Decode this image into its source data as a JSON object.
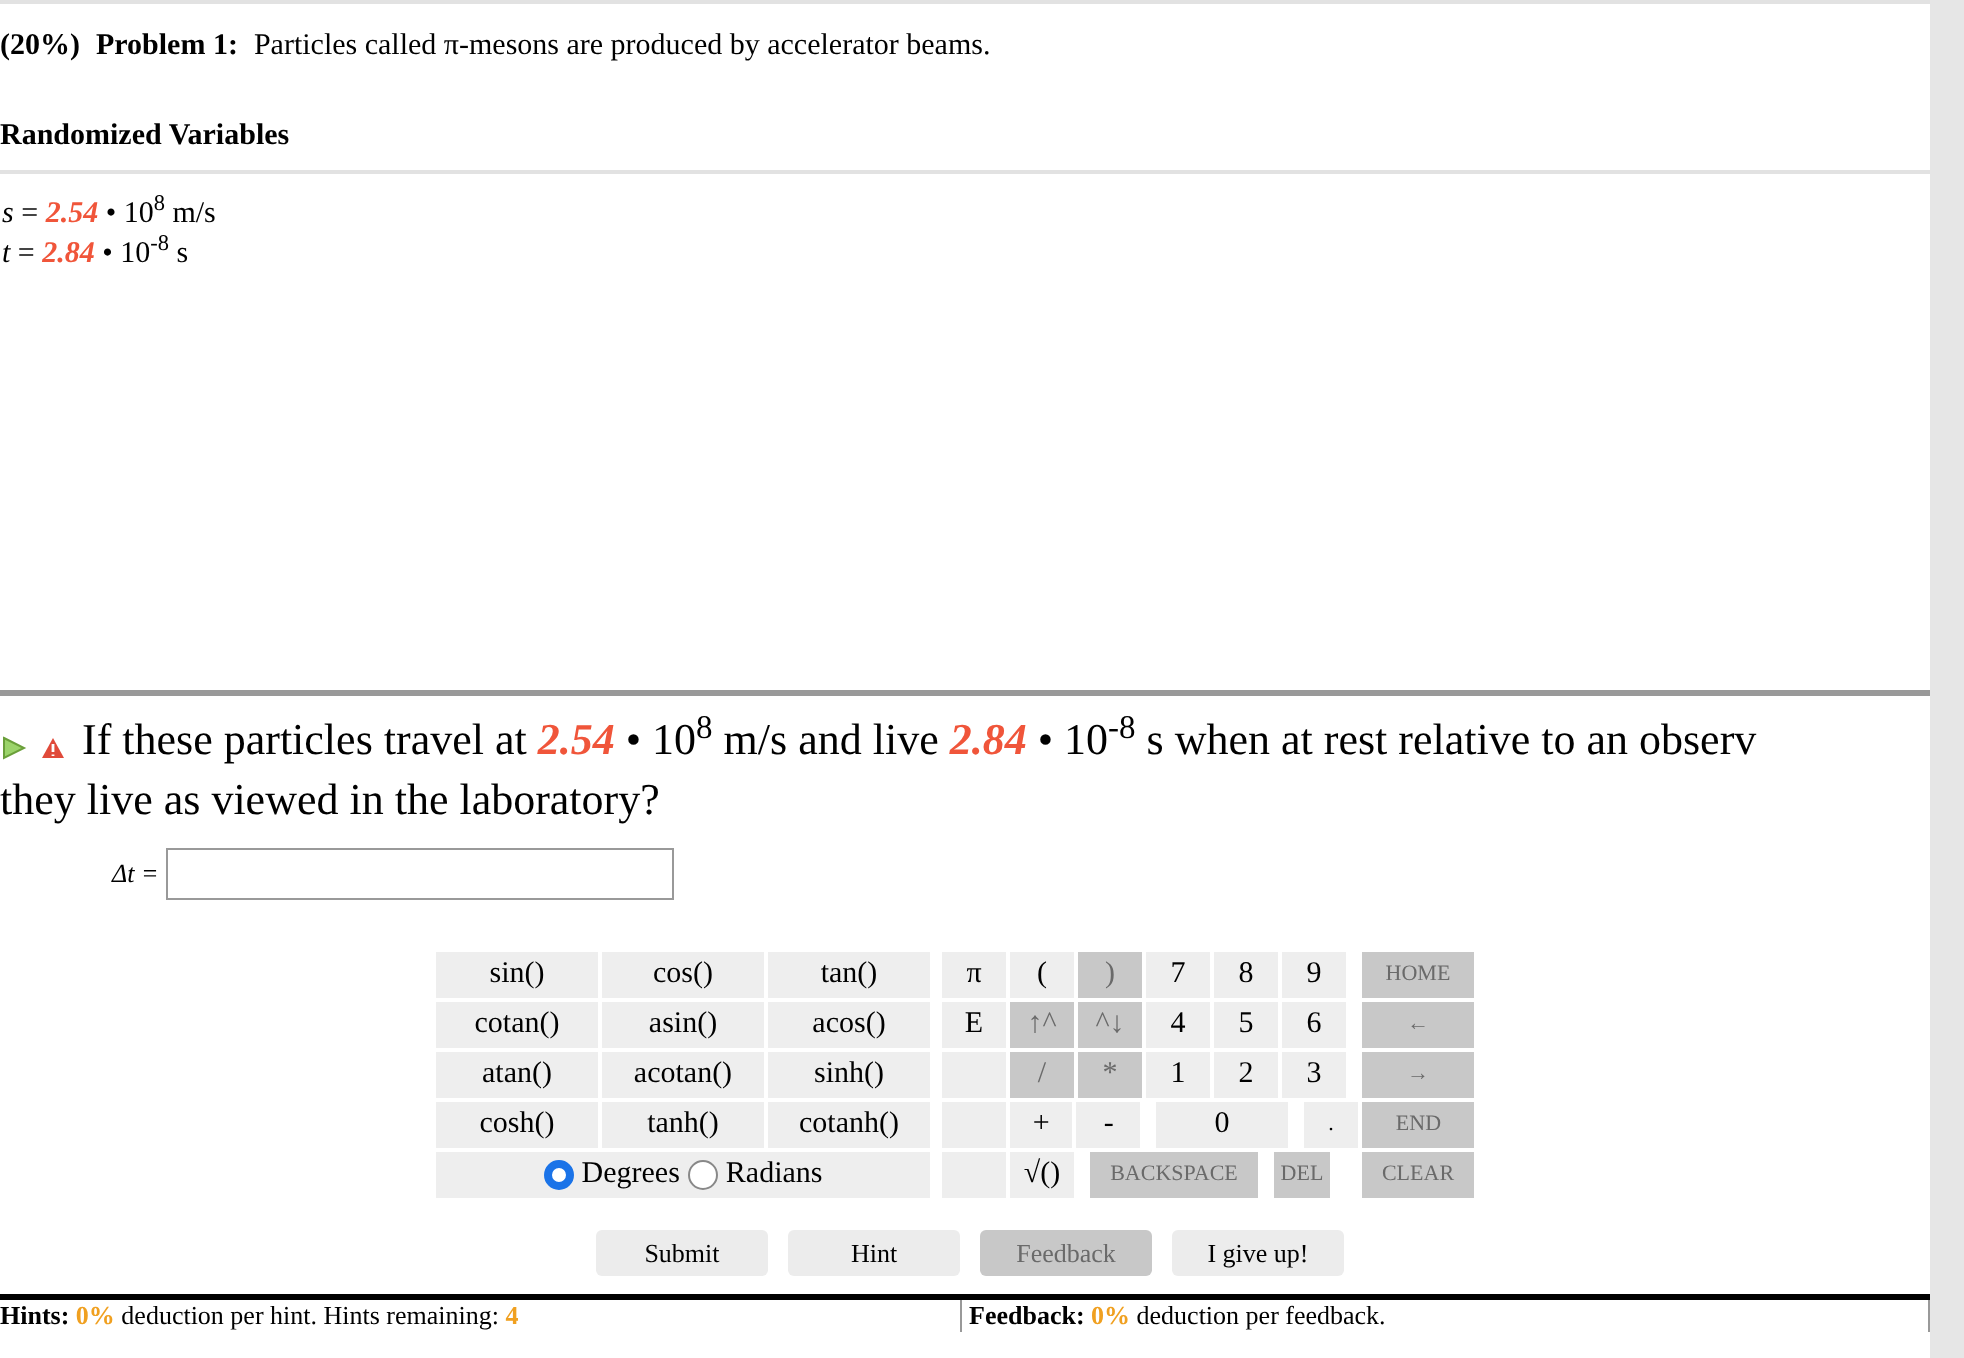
{
  "problem": {
    "weight": "(20%)",
    "label": "Problem 1:",
    "text": "Particles called π-mesons are produced by accelerator beams."
  },
  "variables_heading": "Randomized Variables",
  "variables": [
    {
      "name": "s",
      "sign": "=",
      "value": "2.54",
      "power": "• 10$^{8}$ m/s"
    },
    {
      "name": "t",
      "sign": "=",
      "value": "2.84",
      "power": "• 10$^{-8}$ s"
    }
  ],
  "question": {
    "segments": [
      {
        "kind": "text",
        "text": "If these particles travel at "
      },
      {
        "kind": "value",
        "text": "2.54"
      },
      {
        "kind": "text",
        "text": " • 10$^{8}$ m/s and live "
      },
      {
        "kind": "value",
        "text": "2.84"
      },
      {
        "kind": "text",
        "text": " • 10$^{-8}$ s when at rest relative to an observ"
      },
      {
        "kind": "break"
      },
      {
        "kind": "text",
        "text": "they live as viewed in the laboratory?"
      }
    ]
  },
  "answer": {
    "label": "Δt ="
  },
  "functions": [
    [
      "sin()",
      "cos()",
      "tan()"
    ],
    [
      "cotan()",
      "asin()",
      "acos()"
    ],
    [
      "atan()",
      "acotan()",
      "sinh()"
    ],
    [
      "cosh()",
      "tanh()",
      "cotanh()"
    ]
  ],
  "angle_modes": [
    {
      "label": "Degrees",
      "selected": true
    },
    {
      "label": "Radians",
      "selected": false
    }
  ],
  "keypad": [
    [
      {
        "kind": "key",
        "label": "π",
        "disabled": false
      },
      {
        "kind": "key",
        "label": "(",
        "disabled": false
      },
      {
        "kind": "key",
        "label": ")",
        "disabled": true
      },
      {
        "kind": "key",
        "label": "7",
        "disabled": false
      },
      {
        "kind": "key",
        "label": "8",
        "disabled": false
      },
      {
        "kind": "key",
        "label": "9",
        "disabled": false
      },
      {
        "kind": "nav",
        "label": "HOME",
        "disabled": true
      }
    ],
    [
      {
        "kind": "key",
        "label": "E",
        "disabled": false
      },
      {
        "kind": "key",
        "label": "↑^",
        "disabled": true
      },
      {
        "kind": "key",
        "label": "^↓",
        "disabled": true
      },
      {
        "kind": "key",
        "label": "4",
        "disabled": false
      },
      {
        "kind": "key",
        "label": "5",
        "disabled": false
      },
      {
        "kind": "key",
        "label": "6",
        "disabled": false
      },
      {
        "kind": "nav",
        "label": "←",
        "disabled": true
      }
    ],
    [
      {
        "kind": "blank"
      },
      {
        "kind": "key",
        "label": "/",
        "disabled": true
      },
      {
        "kind": "key",
        "label": "*",
        "disabled": true
      },
      {
        "kind": "key",
        "label": "1",
        "disabled": false
      },
      {
        "kind": "key",
        "label": "2",
        "disabled": false
      },
      {
        "kind": "key",
        "label": "3",
        "disabled": false
      },
      {
        "kind": "nav",
        "label": "→",
        "disabled": true
      }
    ],
    [
      {
        "kind": "blank"
      },
      {
        "kind": "key",
        "label": "+",
        "disabled": false
      },
      {
        "kind": "key",
        "label": "-",
        "disabled": false
      },
      {
        "kind": "double",
        "label": "0",
        "disabled": false
      },
      {
        "kind": "small",
        "label": ".",
        "disabled": false
      },
      {
        "kind": "nav",
        "label": "END",
        "disabled": true
      }
    ],
    [
      {
        "kind": "blank"
      },
      {
        "kind": "key",
        "label": "√()",
        "disabled": false
      },
      {
        "kind": "long",
        "label": "BACKSPACE",
        "disabled": true
      },
      {
        "kind": "small",
        "label": "DEL",
        "disabled": true
      },
      {
        "kind": "nav",
        "label": "CLEAR",
        "disabled": true
      }
    ]
  ],
  "buttons": [
    {
      "label": "Submit",
      "disabled": false
    },
    {
      "label": "Hint",
      "disabled": false
    },
    {
      "label": "Feedback",
      "disabled": true
    },
    {
      "label": "I give up!",
      "disabled": false
    }
  ],
  "footer": [
    {
      "label": "Hints:",
      "value": "0%",
      "text": "deduction per hint. Hints remaining:",
      "count": "4"
    },
    {
      "label": "Feedback:",
      "value": "0%",
      "text": "deduction per feedback."
    }
  ]
}
